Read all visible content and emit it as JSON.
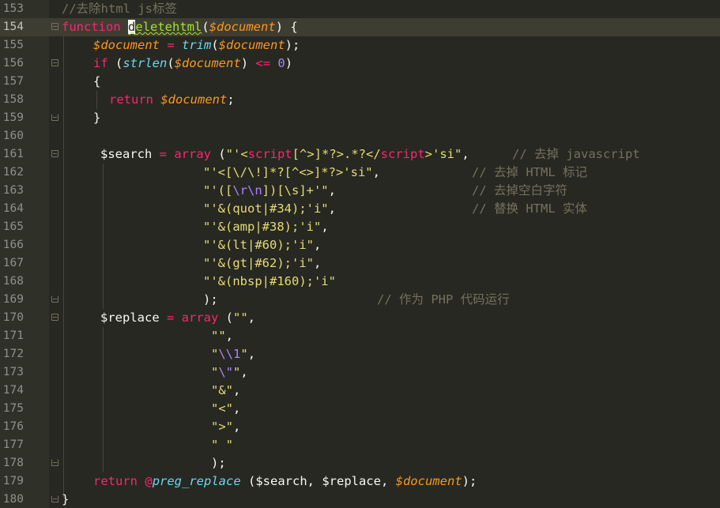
{
  "lines": [
    {
      "n": "153"
    },
    {
      "n": "154"
    },
    {
      "n": "155"
    },
    {
      "n": "156"
    },
    {
      "n": "157"
    },
    {
      "n": "158"
    },
    {
      "n": "159"
    },
    {
      "n": "160"
    },
    {
      "n": "161"
    },
    {
      "n": "162"
    },
    {
      "n": "163"
    },
    {
      "n": "164"
    },
    {
      "n": "165"
    },
    {
      "n": "166"
    },
    {
      "n": "167"
    },
    {
      "n": "168"
    },
    {
      "n": "169"
    },
    {
      "n": "170"
    },
    {
      "n": "171"
    },
    {
      "n": "172"
    },
    {
      "n": "173"
    },
    {
      "n": "174"
    },
    {
      "n": "175"
    },
    {
      "n": "176"
    },
    {
      "n": "177"
    },
    {
      "n": "178"
    },
    {
      "n": "179"
    },
    {
      "n": "180"
    }
  ],
  "code": {
    "l153": {
      "comment": "//去除html js标签"
    },
    "l154": {
      "kw": "function",
      "cursor_char": "d",
      "fname_rest": "eletehtml",
      "open": "(",
      "var": "$document",
      "close": ") {"
    },
    "l155": {
      "var": "$document",
      "eq": " = ",
      "fn": "trim",
      "open": "(",
      "var2": "$document",
      "close": ");"
    },
    "l156": {
      "kw": "if",
      "sp": " (",
      "fn": "strlen",
      "open": "(",
      "var": "$document",
      "close": ") ",
      "op": "<=",
      "sp2": " ",
      "num": "0",
      "close2": ")"
    },
    "l157": {
      "brace": "{"
    },
    "l158": {
      "kw": "return",
      "sp": " ",
      "var": "$document",
      "end": ";"
    },
    "l159": {
      "brace": "}"
    },
    "l161": {
      "var": "$search",
      "eq": " = ",
      "kw": "array",
      "sp": " (",
      "s1": "\"'<",
      "t1": "script",
      "s2": "[^>]*?>.*?</",
      "t2": "script",
      "s3": ">'si\"",
      "comma": ",",
      "cm": "// 去掉 javascript"
    },
    "l162": {
      "s": "\"'<[\\/\\!]*?[^<>]*?>'si\"",
      "comma": ",",
      "cm": "// 去掉 HTML 标记"
    },
    "l163": {
      "s1": "\"'([",
      "e": "\\r\\n",
      "s2": "])[\\s]+'\"",
      "comma": ",",
      "cm": "// 去掉空白字符"
    },
    "l164": {
      "s": "\"'&(quot|#34);'i\"",
      "comma": ",",
      "cm": "// 替换 HTML 实体"
    },
    "l165": {
      "s": "\"'&(amp|#38);'i\"",
      "comma": ","
    },
    "l166": {
      "s": "\"'&(lt|#60);'i\"",
      "comma": ","
    },
    "l167": {
      "s": "\"'&(gt|#62);'i\"",
      "comma": ","
    },
    "l168": {
      "s": "\"'&(nbsp|#160);'i\""
    },
    "l169": {
      "p": ");",
      "cm": "// 作为 PHP 代码运行"
    },
    "l170": {
      "var": "$replace",
      "eq": " = ",
      "kw": "array",
      "sp": " (",
      "s": "\"\"",
      "comma": ","
    },
    "l171": {
      "s": "\"\"",
      "comma": ","
    },
    "l172": {
      "s1": "\"",
      "e": "\\\\1",
      "s2": "\"",
      "comma": ","
    },
    "l173": {
      "s1": "\"",
      "e": "\\\"",
      "s2": "\"",
      "comma": ","
    },
    "l174": {
      "s": "\"&\"",
      "comma": ","
    },
    "l175": {
      "s": "\"<\"",
      "comma": ","
    },
    "l176": {
      "s": "\">\"",
      "comma": ","
    },
    "l177": {
      "s": "\" \""
    },
    "l178": {
      "p": ");"
    },
    "l179": {
      "kw": "return",
      "sp": " ",
      "at": "@",
      "fn": "preg_replace",
      "open": " ($search, $replace, ",
      "var": "$document",
      "close": ");"
    },
    "l180": {
      "brace": "}"
    }
  }
}
